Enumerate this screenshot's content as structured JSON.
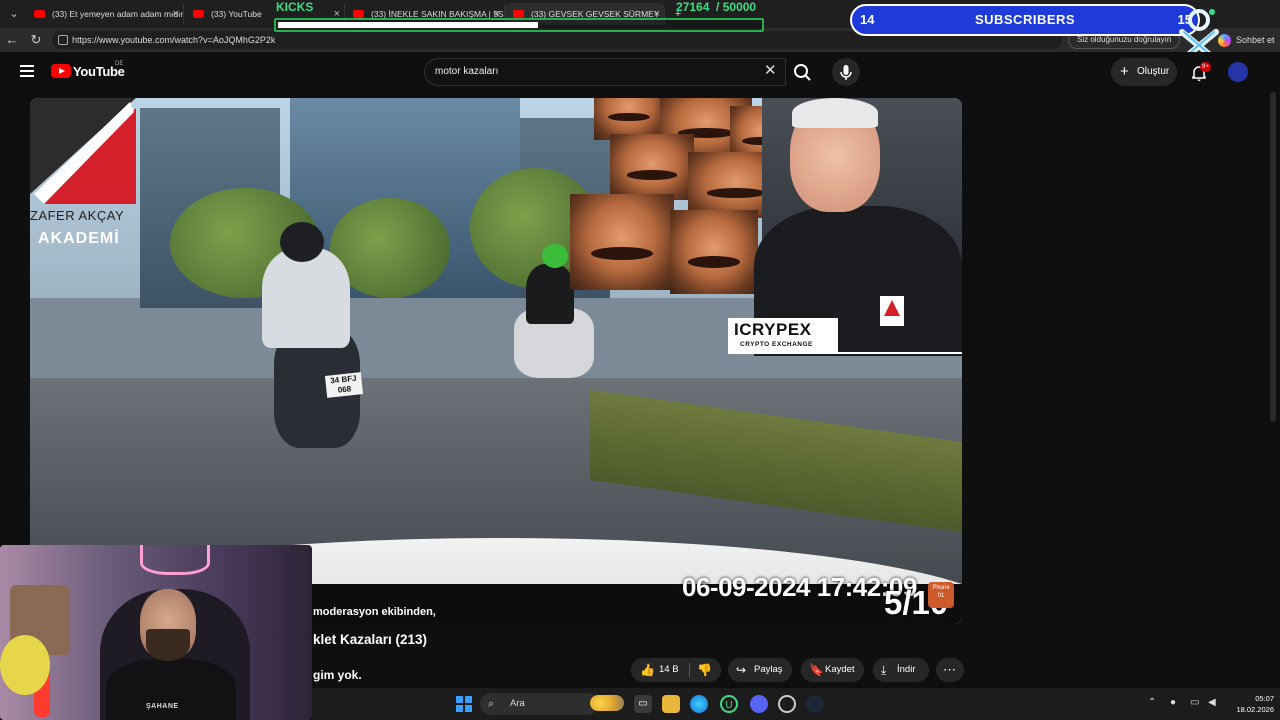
{
  "browser": {
    "tabs": [
      {
        "title": "(33) Et yemeyen adam adam mıdır"
      },
      {
        "title": "(33) YouTube"
      },
      {
        "title": "(33) İNEKLE SAKIN BAKIŞMA | 5Sn"
      },
      {
        "title": "(33) GEVSEK GEVSEK SÜRMEY"
      }
    ],
    "url": "https://www.youtube.com/watch?v=AoJQMhG2P2k",
    "verify_text": "Siz olduğunuzu doğrulayın",
    "chat_label": "Sohbet et"
  },
  "overlays": {
    "kicks": {
      "label": "KICKS",
      "current": "27164",
      "goal": "/ 50000",
      "progress": 0.54
    },
    "subscribers": {
      "label": "SUBSCRIBERS",
      "current": "14",
      "goal": "15"
    }
  },
  "youtube": {
    "logo_text": "YouTube",
    "country": "DE",
    "search_query": "motor kazaları",
    "create_label": "Oluştur",
    "notification_count": "9+"
  },
  "video": {
    "brand_name": "ZAFER AKÇAY",
    "brand_sub": "AKADEMİ",
    "plate": [
      "34 BFJ",
      "068"
    ],
    "sponsor": "ICRYPEX",
    "sponsor_sub": "CRYPTO EXCHANGE",
    "timestamp": "06-09-2024 17:42:09",
    "counter": "5/10",
    "phone_badge": [
      "Phone",
      "01"
    ]
  },
  "below": {
    "caption_line": "moderasyon ekibinden,",
    "title": "klet Kazaları (213)",
    "desc": "gim yok.",
    "like_count": "14 B",
    "share_label": "Paylaş",
    "save_label": "Kaydet",
    "download_label": "İndir"
  },
  "webcam": {
    "shirt_text": "ŞAHANE"
  },
  "taskbar": {
    "search_label": "Ara",
    "time": "05:07",
    "date": "18.02.2026"
  }
}
